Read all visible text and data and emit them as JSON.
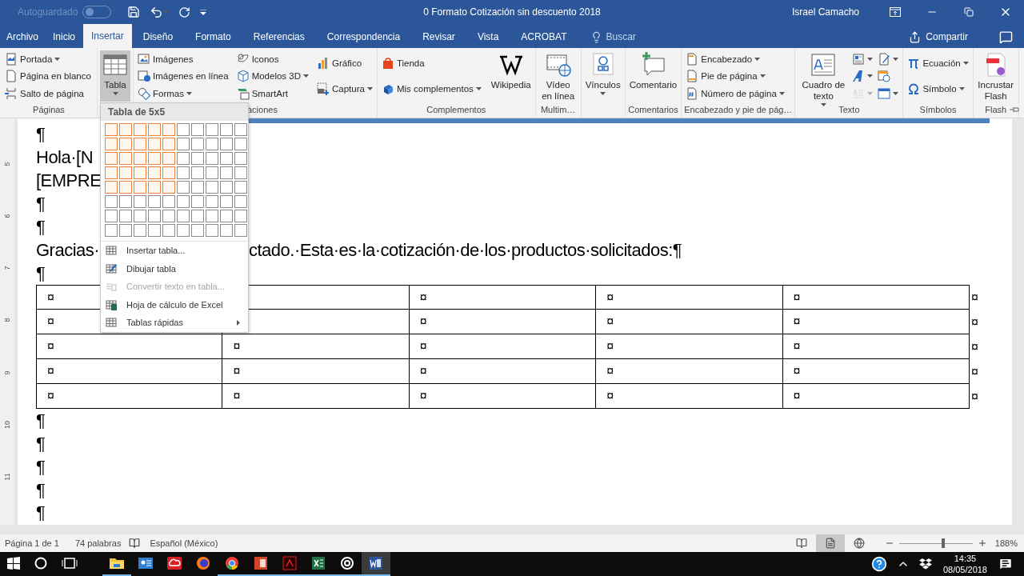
{
  "title_bar": {
    "autosave_label": "Autoguardado",
    "autosave_on": false,
    "title": "0 Formato Cotización sin descuento 2018",
    "user": "Israel Camacho"
  },
  "tabs": [
    {
      "label": "Archivo",
      "selected": false
    },
    {
      "label": "Inicio",
      "selected": false
    },
    {
      "label": "Insertar",
      "selected": true
    },
    {
      "label": "Diseño",
      "selected": false
    },
    {
      "label": "Formato",
      "selected": false
    },
    {
      "label": "Referencias",
      "selected": false
    },
    {
      "label": "Correspondencia",
      "selected": false
    },
    {
      "label": "Revisar",
      "selected": false
    },
    {
      "label": "Vista",
      "selected": false
    },
    {
      "label": "ACROBAT",
      "selected": false
    }
  ],
  "search": {
    "placeholder": "Buscar"
  },
  "share": "Compartir",
  "ribbon": {
    "groups": [
      {
        "label": "Páginas",
        "columns": [
          [
            {
              "kind": "small",
              "label": "Portada",
              "dropdown": true
            },
            {
              "kind": "small",
              "label": "Página en blanco",
              "dropdown": false
            },
            {
              "kind": "small",
              "label": "Salto de página",
              "dropdown": false
            }
          ]
        ]
      },
      {
        "columns": [
          [
            {
              "kind": "large",
              "label": "Tabla",
              "dropdown": true,
              "selected": true
            }
          ]
        ]
      },
      {
        "label": "aciones",
        "label_clipped": true,
        "columns": [
          [
            {
              "kind": "small",
              "label": "Imágenes",
              "dropdown": false
            },
            {
              "kind": "small",
              "label": "Imágenes en línea",
              "dropdown": false
            },
            {
              "kind": "small",
              "label": "Formas",
              "dropdown": true
            }
          ],
          [
            {
              "kind": "small",
              "label": "Iconos",
              "dropdown": false
            },
            {
              "kind": "small",
              "label": "Modelos 3D",
              "dropdown": true
            },
            {
              "kind": "small",
              "label": "SmartArt",
              "dropdown": false
            }
          ],
          [
            {
              "kind": "small",
              "label": "Gráfico",
              "dropdown": false
            },
            {
              "kind": "small",
              "label": "Captura",
              "dropdown": true
            }
          ]
        ]
      },
      {
        "label": "Complementos",
        "columns": [
          [
            {
              "kind": "small",
              "label": "Tienda",
              "dropdown": false
            },
            {
              "kind": "small",
              "label": "Mis complementos",
              "dropdown": true
            }
          ],
          [
            {
              "kind": "large",
              "label": "Wikipedia",
              "dropdown": false,
              "selected": false
            }
          ]
        ]
      },
      {
        "label": "Multim…",
        "columns": [
          [
            {
              "kind": "large",
              "label": "Vídeo en línea",
              "dropdown": false,
              "selected": false
            }
          ]
        ]
      },
      {
        "columns": [
          [
            {
              "kind": "large",
              "label": "Vínculos",
              "dropdown": true,
              "selected": false
            }
          ]
        ]
      },
      {
        "label": "Comentarios",
        "columns": [
          [
            {
              "kind": "large",
              "label": "Comentario",
              "dropdown": false,
              "selected": false
            }
          ]
        ]
      },
      {
        "label": "Encabezado y pie de pág…",
        "columns": [
          [
            {
              "kind": "small",
              "label": "Encabezado",
              "dropdown": true
            },
            {
              "kind": "small",
              "label": "Pie de página",
              "dropdown": true
            },
            {
              "kind": "small",
              "label": "Número de página",
              "dropdown": true
            }
          ]
        ]
      },
      {
        "label": "Texto",
        "columns": [
          [
            {
              "kind": "large",
              "label": "Cuadro de texto",
              "dropdown": true,
              "selected": false
            }
          ],
          [
            {
              "kind": "icon",
              "dropdown": true,
              "disabled": false
            },
            {
              "kind": "icon",
              "dropdown": true,
              "disabled": false
            },
            {
              "kind": "icon",
              "dropdown": true,
              "disabled": true
            }
          ],
          [
            {
              "kind": "icon",
              "dropdown": true,
              "disabled": false
            },
            {
              "kind": "icon",
              "dropdown": false,
              "disabled": false
            },
            {
              "kind": "icon",
              "dropdown": true,
              "disabled": false
            }
          ]
        ]
      },
      {
        "label": "Símbolos",
        "columns": [
          [
            {
              "kind": "small",
              "label": "Ecuación",
              "dropdown": true
            },
            {
              "kind": "small",
              "label": "Símbolo",
              "dropdown": true
            }
          ]
        ]
      },
      {
        "label": "Flash",
        "columns": [
          [
            {
              "kind": "large",
              "label": "Incrustar Flash",
              "dropdown": false,
              "selected": false
            }
          ]
        ]
      }
    ]
  },
  "table_menu": {
    "title": "Tabla de 5x5",
    "grid": [
      [
        true,
        true,
        true,
        true,
        true,
        false,
        false,
        false,
        false,
        false
      ],
      [
        true,
        true,
        true,
        true,
        true,
        false,
        false,
        false,
        false,
        false
      ],
      [
        true,
        true,
        true,
        true,
        true,
        false,
        false,
        false,
        false,
        false
      ],
      [
        true,
        true,
        true,
        true,
        true,
        false,
        false,
        false,
        false,
        false
      ],
      [
        true,
        true,
        true,
        true,
        true,
        false,
        false,
        false,
        false,
        false
      ],
      [
        false,
        false,
        false,
        false,
        false,
        false,
        false,
        false,
        false,
        false
      ],
      [
        false,
        false,
        false,
        false,
        false,
        false,
        false,
        false,
        false,
        false
      ],
      [
        false,
        false,
        false,
        false,
        false,
        false,
        false,
        false,
        false,
        false
      ]
    ],
    "items": [
      {
        "label": "Insertar tabla...",
        "disabled": false,
        "submenu": false
      },
      {
        "label": "Dibujar tabla",
        "disabled": false,
        "submenu": false
      },
      {
        "label": "Convertir texto en tabla...",
        "disabled": true,
        "submenu": false
      },
      {
        "label": "Hoja de cálculo de Excel",
        "disabled": false,
        "submenu": false
      },
      {
        "label": "Tablas rápidas",
        "disabled": false,
        "submenu": true
      }
    ]
  },
  "ruler": [
    "5",
    "6",
    "7",
    "8",
    "9",
    "10",
    "11"
  ],
  "document": [
    {
      "kind": "text",
      "segments": [
        "¶"
      ]
    },
    {
      "kind": "text",
      "segments": [
        "Hola·[N"
      ]
    },
    {
      "kind": "text",
      "segments": [
        "[EMPRE"
      ]
    },
    {
      "kind": "text",
      "segments": [
        "¶"
      ]
    },
    {
      "kind": "text",
      "segments": [
        "¶"
      ]
    },
    {
      "kind": "text",
      "segments": [
        "Gracias·",
        "ctado.·Esta·es·la·cotización·de·los·productos·solicitados:¶"
      ]
    },
    {
      "kind": "text",
      "segments": [
        "¶"
      ]
    },
    {
      "kind": "table",
      "rows": [
        {
          "cells": [
            "¤",
            null,
            "¤",
            "¤",
            "¤"
          ],
          "end": "¤"
        },
        {
          "cells": [
            "¤",
            null,
            "¤",
            "¤",
            "¤"
          ],
          "end": "¤"
        },
        {
          "cells": [
            "¤",
            "¤",
            "¤",
            "¤",
            "¤"
          ],
          "end": "¤"
        },
        {
          "cells": [
            "¤",
            "¤",
            "¤",
            "¤",
            "¤"
          ],
          "end": "¤"
        },
        {
          "cells": [
            "¤",
            "¤",
            "¤",
            "¤",
            "¤"
          ],
          "end": "¤"
        }
      ]
    },
    {
      "kind": "text",
      "segments": [
        "¶"
      ]
    },
    {
      "kind": "text",
      "segments": [
        "¶"
      ]
    },
    {
      "kind": "text",
      "segments": [
        "¶"
      ]
    },
    {
      "kind": "text",
      "segments": [
        "¶"
      ]
    },
    {
      "kind": "text",
      "segments": [
        "¶"
      ]
    }
  ],
  "status_bar": {
    "page": "Página 1 de 1",
    "words": "74 palabras",
    "language": "Español (México)",
    "views": [
      {
        "selected": false
      },
      {
        "selected": true
      },
      {
        "selected": false
      }
    ],
    "zoom": {
      "level": 0.6,
      "reading": "188%"
    }
  },
  "taskbar": {
    "apps": [
      {
        "running": true,
        "active": false
      },
      {
        "running": false,
        "active": false
      },
      {
        "running": false,
        "active": false
      },
      {
        "running": false,
        "active": false
      },
      {
        "running": true,
        "active": false
      },
      {
        "running": true,
        "active": false
      },
      {
        "running": true,
        "active": false
      },
      {
        "running": true,
        "active": false
      },
      {
        "running": true,
        "active": false
      },
      {
        "running": true,
        "active": true
      }
    ],
    "time": "14:35",
    "date": "08/05/2018"
  }
}
